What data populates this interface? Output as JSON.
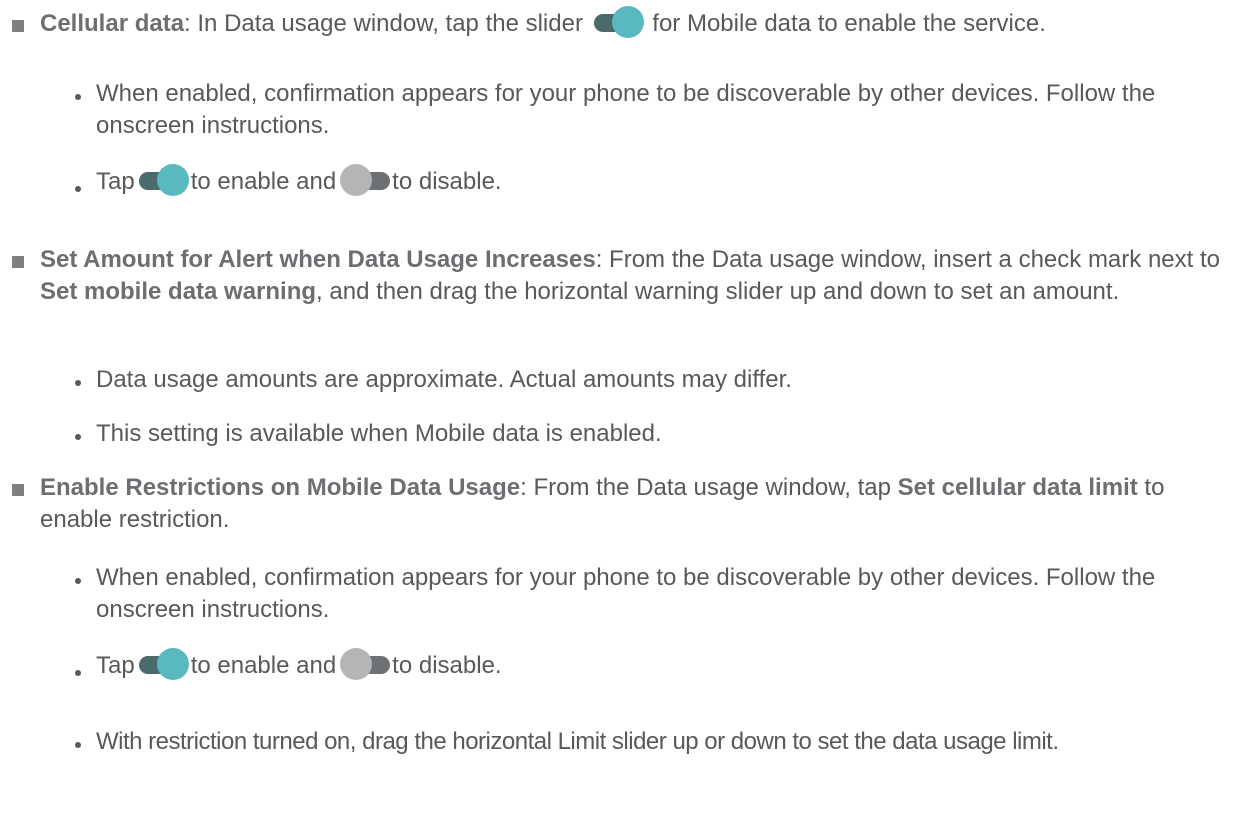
{
  "items": [
    {
      "bold": "Cellular data",
      "before_toggle": ": In Data usage window, tap the slider ",
      "after_toggle": " for Mobile data to enable the service.",
      "subs": [
        {
          "text": "When enabled, confirmation appears for your phone to be discoverable by other devices. Follow the onscreen instructions."
        },
        {
          "tap": "Tap",
          "enable": "to enable and",
          "disable": "to disable."
        }
      ]
    },
    {
      "bold": "Set Amount for Alert when Data Usage Increases",
      "text1": ": From the Data usage window, insert a check mark next to ",
      "bold2": "Set mobile data warning",
      "text2": ", and then drag the horizontal warning slider up and down to set an amount.",
      "subs": [
        {
          "text": "Data usage amounts are approximate. Actual amounts may differ."
        },
        {
          "text": "This setting is available when Mobile data is enabled."
        }
      ]
    },
    {
      "bold": "Enable Restrictions on Mobile Data Usage",
      "text1": ": From the Data usage window, tap ",
      "bold2": "Set cellular data limit",
      "text2": " to enable restriction.",
      "subs": [
        {
          "text": "When enabled, confirmation appears for your phone to be discoverable by other devices. Follow the onscreen instructions."
        },
        {
          "tap": "Tap",
          "enable": "to enable and",
          "disable": "to disable."
        },
        {
          "text": "With restriction turned on, drag the horizontal Limit slider up or down to set the data usage limit."
        }
      ]
    }
  ],
  "colors": {
    "text": "#58595b",
    "bold": "#6d6e71",
    "toggle_on_track": "#4a6a6c",
    "toggle_on_knob": "#5ab8c0",
    "toggle_off_knob": "#b5b5b5"
  },
  "icons": {
    "toggle_on": "toggle-on-icon",
    "toggle_off": "toggle-off-icon"
  }
}
